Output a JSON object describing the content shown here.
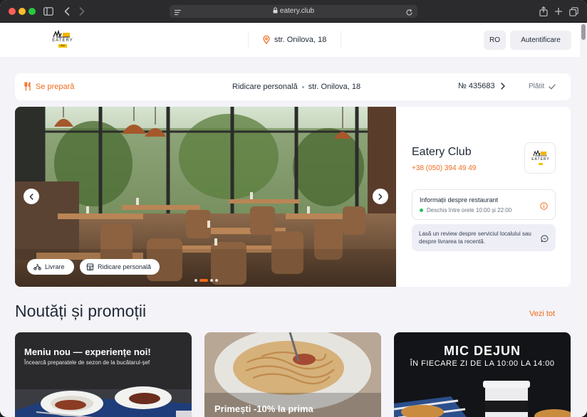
{
  "browser": {
    "url": "eatery.club"
  },
  "header": {
    "logo_text": "EATERY",
    "logo_sub": "club",
    "address": "str. Onilova, 18",
    "lang": "RO",
    "auth": "Autentificare"
  },
  "order": {
    "status": "Se prepară",
    "method": "Ridicare personală",
    "address": "str. Onilova, 18",
    "number": "№ 435683",
    "paid": "Plătit"
  },
  "hero": {
    "pill_delivery": "Livrare",
    "pill_pickup": "Ridicare personală",
    "slide_count": 4,
    "active_slide": 1
  },
  "restaurant": {
    "name": "Eatery Club",
    "phone": "+38 (050) 394 49 49",
    "info_title": "Informații despre restaurant",
    "hours": "Deschis între orele 10:00 și 22:00",
    "review": "Lasă un review despre serviciul localului sau despre livrarea ta recentă."
  },
  "news": {
    "title": "Noutăți și promoții",
    "see_all": "Vezi tot",
    "cards": [
      {
        "title": "Meniu nou — experiențe noi!",
        "subtitle": "Încearcă preparatele de sezon de la bucătarul-șef"
      },
      {
        "title": "Primești -10% la prima"
      },
      {
        "title": "MIC DEJUN",
        "subtitle": "ÎN FIECARE ZI DE LA 10:00 LA 14:00"
      }
    ]
  },
  "colors": {
    "accent": "#f26a1b",
    "page_bg": "#f4f3f8",
    "open_status": "#22c55e"
  }
}
